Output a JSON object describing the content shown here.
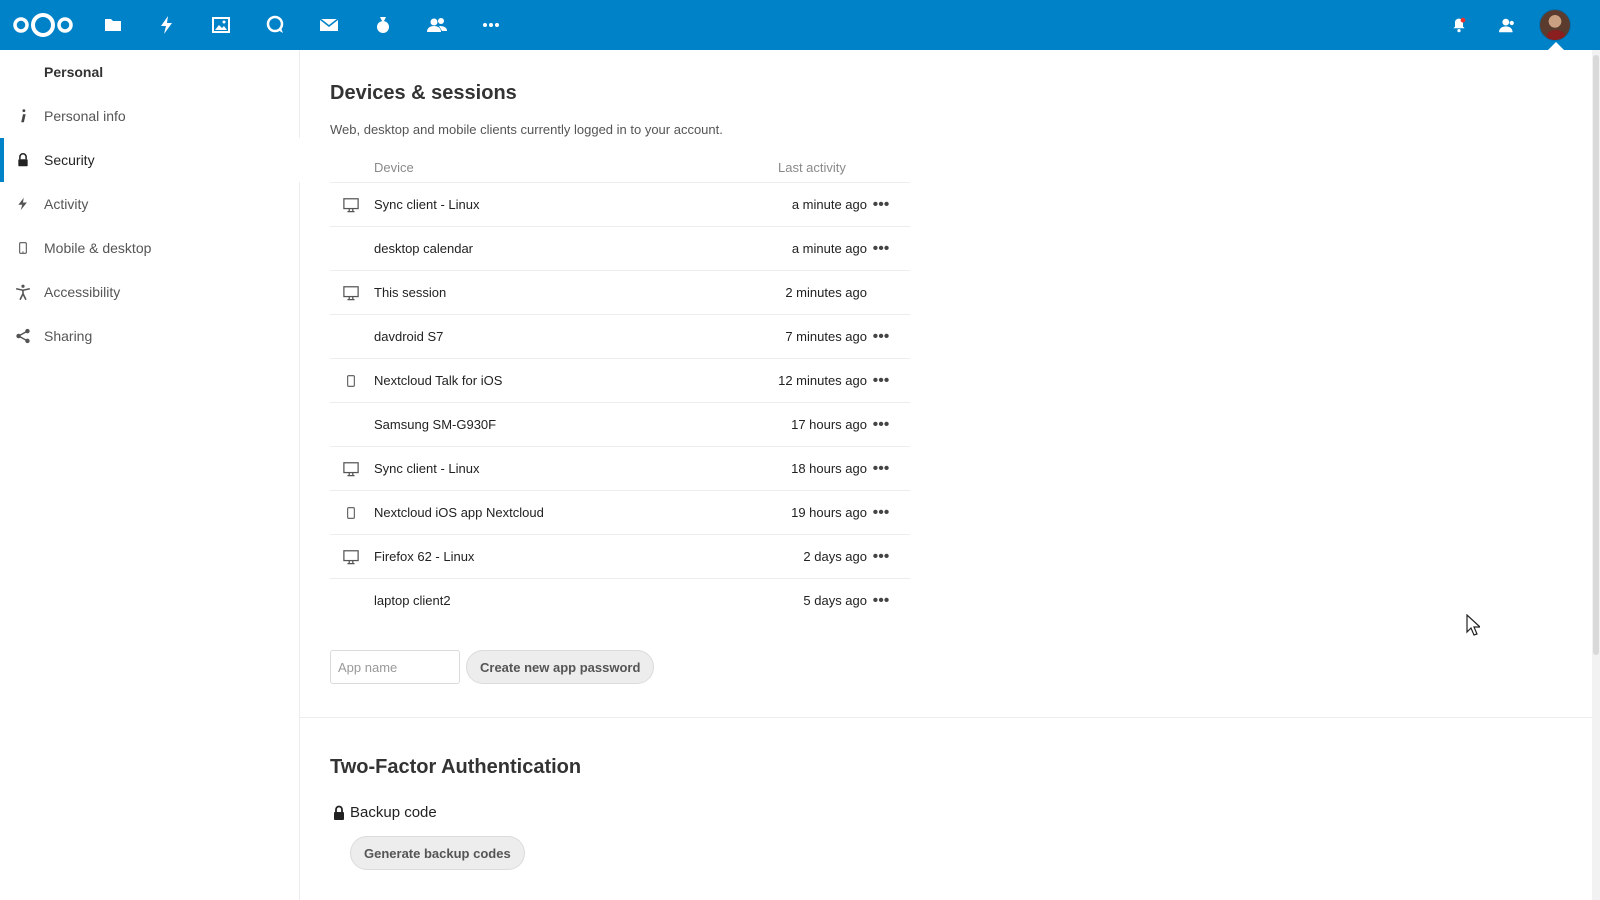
{
  "header": {
    "apps": [
      {
        "name": "files-icon"
      },
      {
        "name": "activity-icon"
      },
      {
        "name": "photos-icon"
      },
      {
        "name": "talk-icon"
      },
      {
        "name": "mail-icon"
      },
      {
        "name": "deck-icon"
      },
      {
        "name": "contacts-icon"
      },
      {
        "name": "more-apps-icon"
      }
    ],
    "right_icons": [
      {
        "name": "notifications-icon"
      },
      {
        "name": "contacts-menu-icon"
      }
    ],
    "colors": {
      "primary": "#0082c9"
    }
  },
  "sidebar": {
    "heading": "Personal",
    "items": [
      {
        "label": "Personal info",
        "icon": "info-icon"
      },
      {
        "label": "Security",
        "icon": "lock-icon",
        "active": true
      },
      {
        "label": "Activity",
        "icon": "activity-icon"
      },
      {
        "label": "Mobile & desktop",
        "icon": "phone-icon"
      },
      {
        "label": "Accessibility",
        "icon": "accessibility-icon"
      },
      {
        "label": "Sharing",
        "icon": "share-icon"
      }
    ]
  },
  "devices": {
    "title": "Devices & sessions",
    "description": "Web, desktop and mobile clients currently logged in to your account.",
    "columns": {
      "device": "Device",
      "last_activity": "Last activity"
    },
    "rows": [
      {
        "name": "Sync client - Linux",
        "time": "a minute ago",
        "icon": "desktop-icon",
        "more": true
      },
      {
        "name": "desktop calendar",
        "time": "a minute ago",
        "icon": "",
        "more": true
      },
      {
        "name": "This session",
        "time": "2 minutes ago",
        "icon": "desktop-icon",
        "more": false
      },
      {
        "name": "davdroid S7",
        "time": "7 minutes ago",
        "icon": "",
        "more": true
      },
      {
        "name": "Nextcloud Talk for iOS",
        "time": "12 minutes ago",
        "icon": "phone-icon",
        "more": true
      },
      {
        "name": "Samsung SM-G930F",
        "time": "17 hours ago",
        "icon": "",
        "more": true
      },
      {
        "name": "Sync client - Linux",
        "time": "18 hours ago",
        "icon": "desktop-icon",
        "more": true
      },
      {
        "name": "Nextcloud iOS app Nextcloud",
        "time": "19 hours ago",
        "icon": "phone-icon",
        "more": true
      },
      {
        "name": "Firefox 62 - Linux",
        "time": "2 days ago",
        "icon": "desktop-icon",
        "more": true
      },
      {
        "name": "laptop client2",
        "time": "5 days ago",
        "icon": "",
        "more": true
      }
    ],
    "more_glyph": "•••",
    "app_name_placeholder": "App name",
    "app_name_value": "",
    "create_button": "Create new app password"
  },
  "two_factor": {
    "title": "Two-Factor Authentication",
    "backup_label": "Backup code",
    "generate_button": "Generate backup codes"
  }
}
